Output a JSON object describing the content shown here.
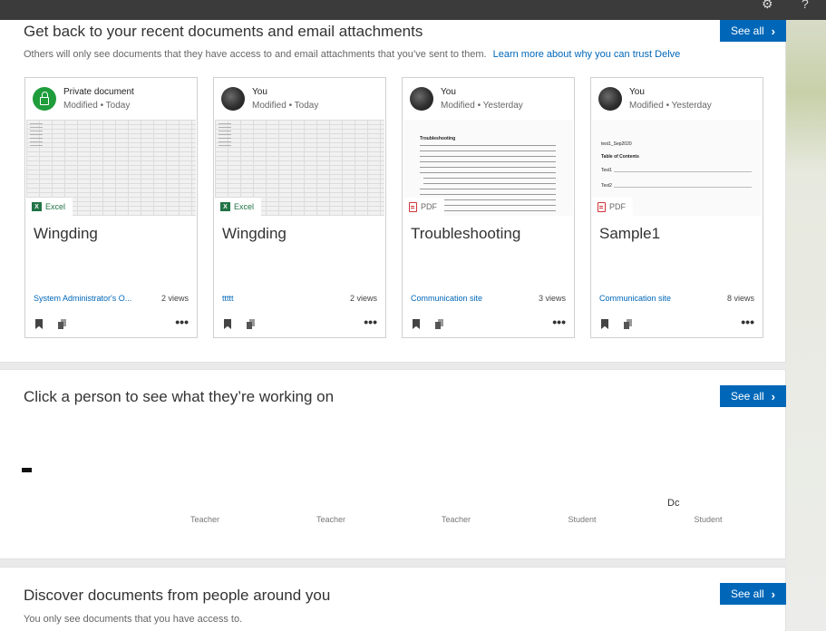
{
  "topbar": {
    "settings_icon": "gear-icon",
    "help_glyph": "?"
  },
  "recent": {
    "title": "Get back to your recent documents and email attachments",
    "subtitle": "Others will only see documents that they have access to and email attachments that you’ve sent to them.",
    "learn_more": "Learn more about why you can trust Delve",
    "see_all": "See all",
    "cards": [
      {
        "who": "Private document",
        "when": "Modified • Today",
        "type": "Excel",
        "name": "Wingding",
        "site": "System Administrator's O...",
        "views": "2 views"
      },
      {
        "who": "You",
        "when": "Modified • Today",
        "type": "Excel",
        "name": "Wingding",
        "site": "ttttt",
        "views": "2 views"
      },
      {
        "who": "You",
        "when": "Modified • Yesterday",
        "type": "PDF",
        "name": "Troubleshooting",
        "site": "Communication site",
        "views": "3 views"
      },
      {
        "who": "You",
        "when": "Modified • Yesterday",
        "type": "PDF",
        "name": "Sample1",
        "site": "Communication site",
        "views": "8 views"
      }
    ],
    "thumb_text": {
      "troubleshooting": "Troubleshooting",
      "sample_title": "test1_Sep2020",
      "sample_toc": "Table of Contents",
      "sample_t1": "Test1",
      "sample_t2": "Test2"
    },
    "more_glyph": "•••"
  },
  "people": {
    "title": "Click a person to see what they’re working on",
    "see_all": "See all",
    "roles": [
      "Teacher",
      "Teacher",
      "Teacher",
      "Student",
      "Student"
    ],
    "partial_name": "Dc"
  },
  "discover": {
    "title": "Discover documents from people around you",
    "subtitle": "You only see documents that you have access to.",
    "see_all": "See all"
  },
  "colors": {
    "accent": "#0067b8",
    "excel": "#217346",
    "pdf": "#d13438",
    "private": "#1f9d3c"
  }
}
